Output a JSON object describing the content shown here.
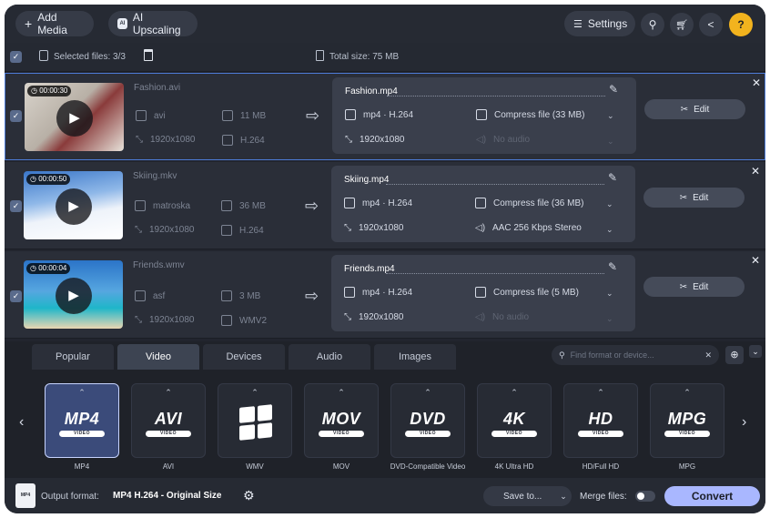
{
  "toolbar": {
    "add_media": "Add Media",
    "ai_upscaling": "AI Upscaling",
    "settings": "Settings",
    "help": "?"
  },
  "selection": {
    "selected_files": "Selected files: 3/3",
    "total_size": "Total size: 75 MB"
  },
  "files": [
    {
      "duration": "00:00:30",
      "src_name": "Fashion.avi",
      "src_container": "avi",
      "src_size": "11 MB",
      "src_resolution": "1920x1080",
      "src_codec": "H.264",
      "out_name": "Fashion.mp4",
      "out_format": "mp4 · H.264",
      "out_resolution": "1920x1080",
      "compress": "Compress file (33 MB)",
      "audio": "No audio",
      "audio_disabled": true,
      "edit": "Edit"
    },
    {
      "duration": "00:00:50",
      "src_name": "Skiing.mkv",
      "src_container": "matroska",
      "src_size": "36 MB",
      "src_resolution": "1920x1080",
      "src_codec": "H.264",
      "out_name": "Skiing.mp4",
      "out_format": "mp4 · H.264",
      "out_resolution": "1920x1080",
      "compress": "Compress file (36 MB)",
      "audio": "AAC 256 Kbps Stereo",
      "audio_disabled": false,
      "edit": "Edit"
    },
    {
      "duration": "00:00:04",
      "src_name": "Friends.wmv",
      "src_container": "asf",
      "src_size": "3 MB",
      "src_resolution": "1920x1080",
      "src_codec": "WMV2",
      "out_name": "Friends.mp4",
      "out_format": "mp4 · H.264",
      "out_resolution": "1920x1080",
      "compress": "Compress file (5 MB)",
      "audio": "No audio",
      "audio_disabled": true,
      "edit": "Edit"
    }
  ],
  "format_tabs": [
    "Popular",
    "Video",
    "Devices",
    "Audio",
    "Images"
  ],
  "active_tab": "Video",
  "search": {
    "placeholder": "Find format or device..."
  },
  "formats": [
    {
      "logo": "MP4",
      "sub": "VIDEO",
      "label": "MP4",
      "active": true
    },
    {
      "logo": "AVI",
      "sub": "VIDEO",
      "label": "AVI"
    },
    {
      "logo": "",
      "sub": "",
      "label": "WMV"
    },
    {
      "logo": "MOV",
      "sub": "VIDEO",
      "label": "MOV"
    },
    {
      "logo": "DVD",
      "sub": "VIDEO",
      "label": "DVD-Compatible Video"
    },
    {
      "logo": "4K",
      "sub": "VIDEO",
      "label": "4K Ultra HD"
    },
    {
      "logo": "HD",
      "sub": "VIDEO",
      "label": "HD/Full HD"
    },
    {
      "logo": "MPG",
      "sub": "VIDEO",
      "label": "MPG"
    }
  ],
  "bottom": {
    "output_label": "Output format:",
    "output_value": "MP4 H.264 - Original Size",
    "save_to": "Save to...",
    "merge_files": "Merge files:",
    "convert": "Convert",
    "format_badge": "MP4"
  },
  "colors": {
    "accent": "#a9b7ff",
    "selected_border": "#4d7bd6",
    "help": "#f2b31e",
    "background": "#22252e"
  }
}
